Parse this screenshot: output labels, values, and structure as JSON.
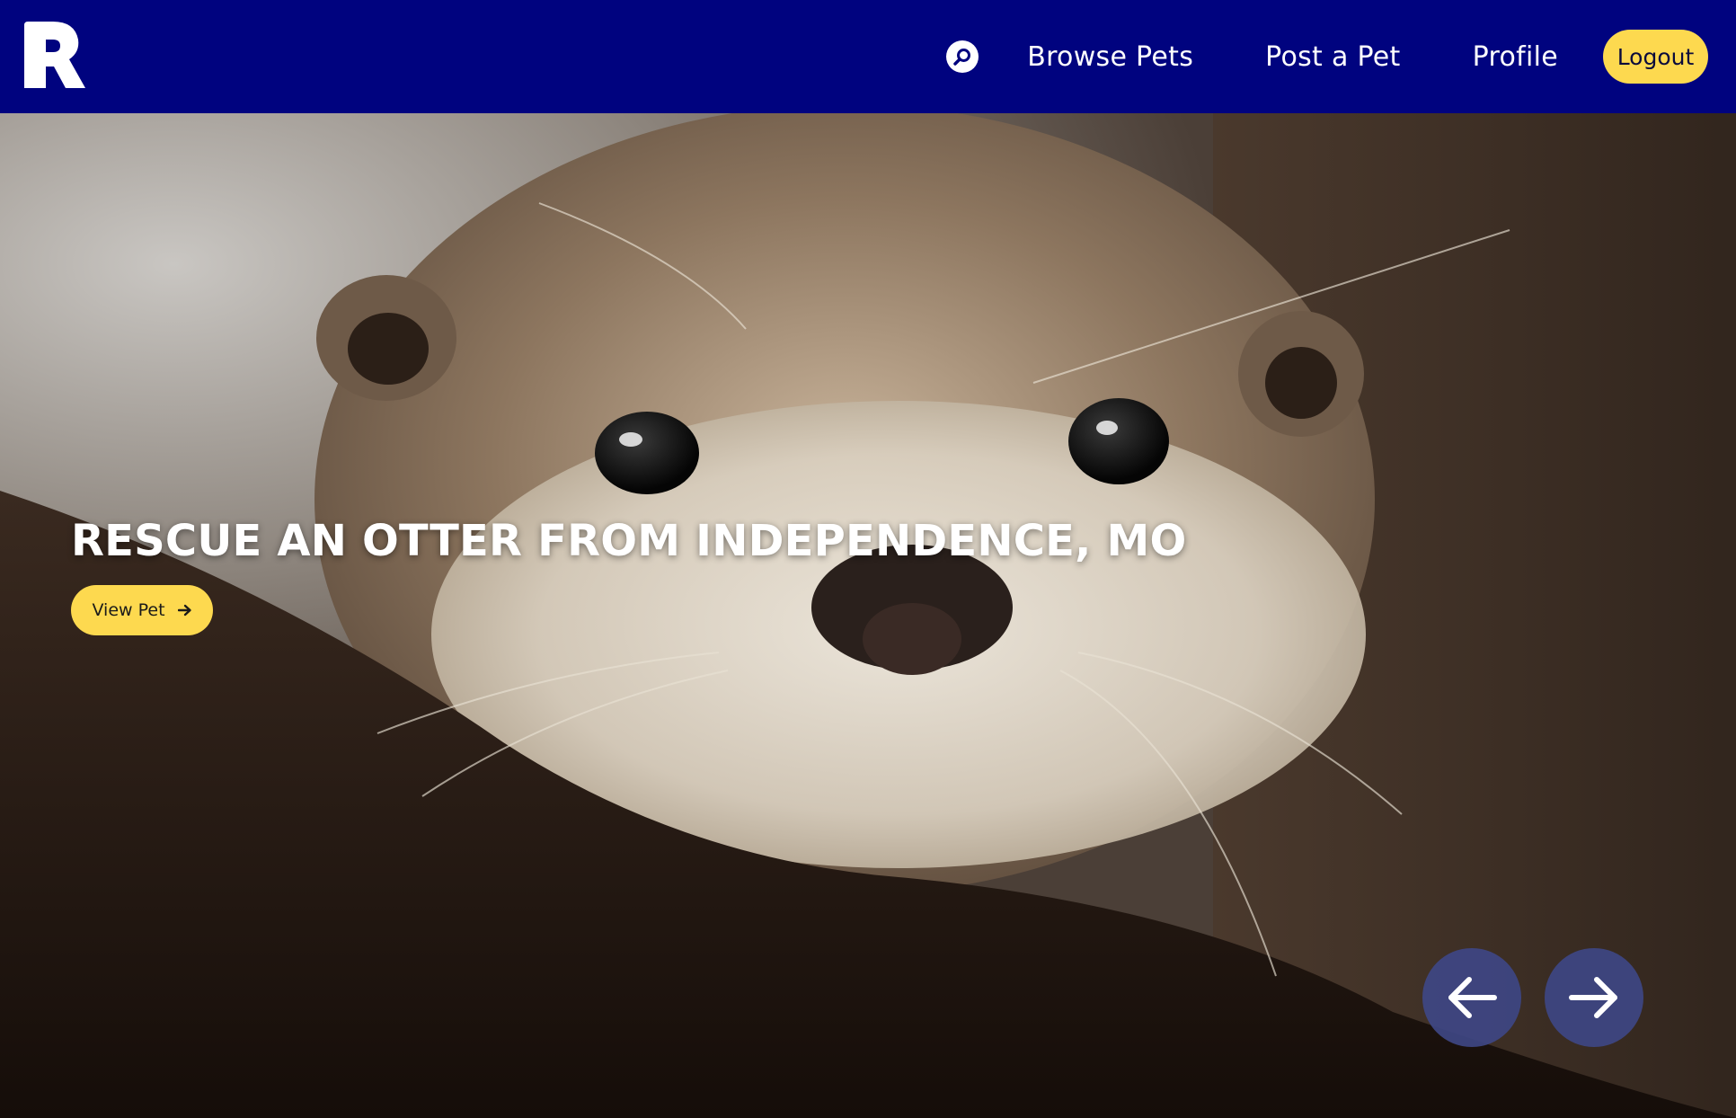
{
  "brand": {
    "logo_letter": "R",
    "logo_icon": "brand-r-logo-icon",
    "nav_color": "#00037f",
    "accent_color": "#fdd94f"
  },
  "nav": {
    "search_icon": "search-icon",
    "links": [
      {
        "label": "Browse Pets"
      },
      {
        "label": "Post a Pet"
      },
      {
        "label": "Profile"
      }
    ],
    "logout_label": "Logout"
  },
  "hero": {
    "title": "RESCUE AN OTTER FROM INDEPENDENCE, MO",
    "cta_label": "View Pet",
    "cta_icon": "arrow-right-icon",
    "prev_icon": "arrow-left-icon",
    "next_icon": "arrow-right-icon",
    "image_subject": "otter"
  }
}
